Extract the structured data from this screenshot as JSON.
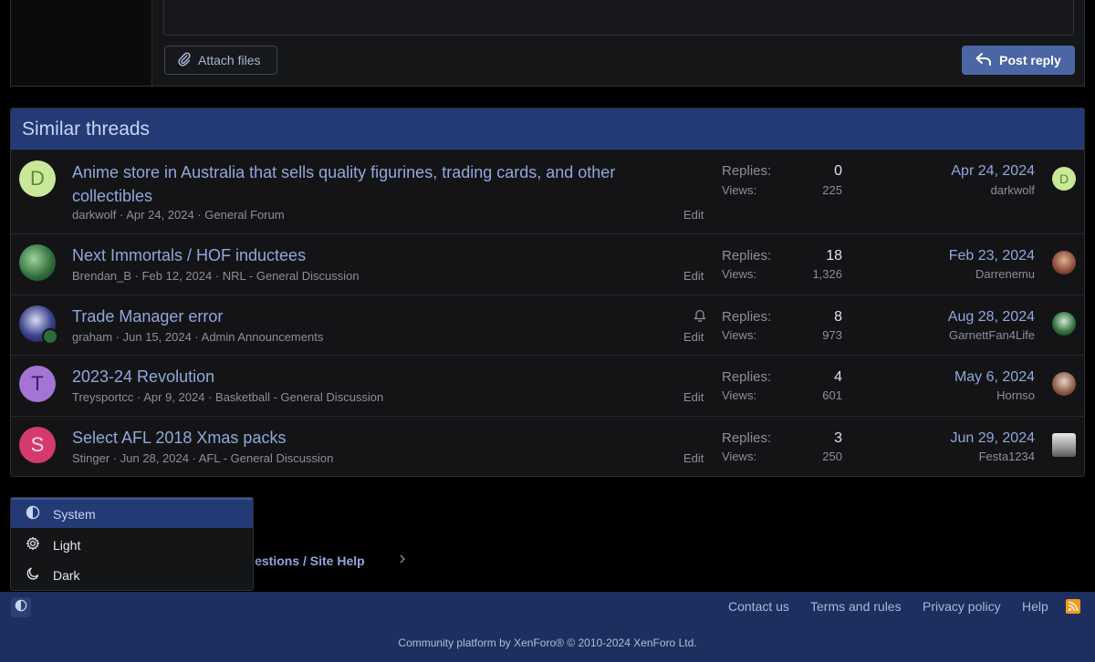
{
  "reply": {
    "attach_label": "Attach files",
    "post_label": "Post reply"
  },
  "similar": {
    "title": "Similar threads",
    "replies_label": "Replies:",
    "views_label": "Views:",
    "edit_label": "Edit",
    "threads": [
      {
        "avatar_letter": "D",
        "avatar_color": "#c9e89a",
        "title": "Anime store in Australia that sells quality figurines, trading cards, and other collectibles",
        "meta": "darkwolf · Apr 24, 2024 · General Forum",
        "replies": "0",
        "views": "225",
        "last_date": "Apr 24, 2024",
        "last_user": "darkwolf",
        "last_avatar_letter": "D"
      },
      {
        "avatar_letter": "",
        "avatar_color": "#2d6b3a",
        "title": "Next Immortals / HOF inductees",
        "meta": "Brendan_B · Feb 12, 2024 · NRL - General Discussion",
        "replies": "18",
        "views": "1,326",
        "last_date": "Feb 23, 2024",
        "last_user": "Darrenemu",
        "last_avatar_letter": ""
      },
      {
        "avatar_letter": "",
        "avatar_color": "#3a3f8a",
        "title": "Trade Manager error",
        "meta": "graham · Jun 15, 2024 · Admin Announcements",
        "replies": "8",
        "views": "973",
        "last_date": "Aug 28, 2024",
        "last_user": "GarnettFan4Life",
        "last_avatar_letter": ""
      },
      {
        "avatar_letter": "T",
        "avatar_color": "#a374d6",
        "title": "2023-24 Revolution",
        "meta": "Treysportcc · Apr 9, 2024 · Basketball - General Discussion",
        "replies": "4",
        "views": "601",
        "last_date": "May 6, 2024",
        "last_user": "Hornso",
        "last_avatar_letter": ""
      },
      {
        "avatar_letter": "S",
        "avatar_color": "#d43a6e",
        "title": "Select AFL 2018 Xmas packs",
        "meta": "Stinger · Jun 28, 2024 · AFL - General Discussion",
        "replies": "3",
        "views": "250",
        "last_date": "Jun 29, 2024",
        "last_user": "Festa1234",
        "last_avatar_letter": ""
      }
    ]
  },
  "breadcrumb": {
    "label": "ggestions / Site Help"
  },
  "theme_menu": {
    "items": [
      {
        "label": "System",
        "icon": "half-circle-icon"
      },
      {
        "label": "Light",
        "icon": "gear-icon"
      },
      {
        "label": "Dark",
        "icon": "moon-icon"
      }
    ]
  },
  "footer": {
    "links": [
      "Contact us",
      "Terms and rules",
      "Privacy policy",
      "Help"
    ],
    "copyright": "Community platform by XenForo® © 2010-2024 XenForo Ltd."
  }
}
